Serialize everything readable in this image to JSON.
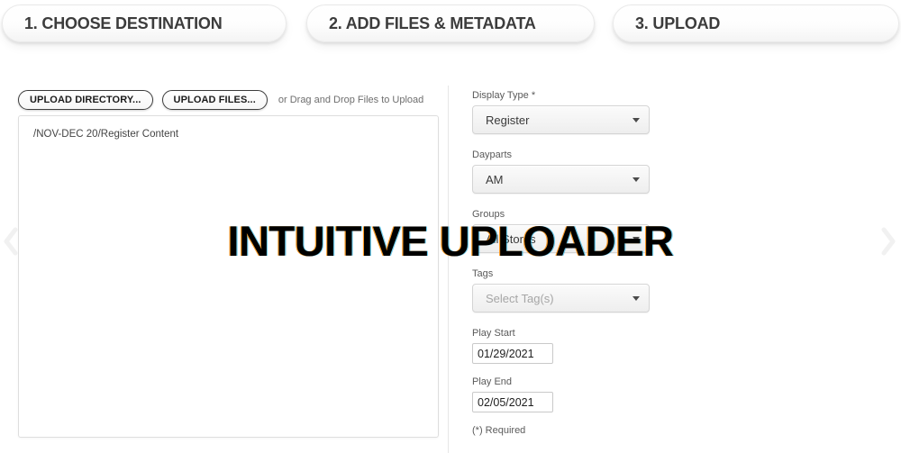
{
  "steps": {
    "tabs": [
      {
        "label": "1. CHOOSE DESTINATION",
        "name": "tab-choose-destination"
      },
      {
        "label": "2. ADD FILES & METADATA",
        "name": "tab-add-files-metadata"
      },
      {
        "label": "3. UPLOAD",
        "name": "tab-upload"
      }
    ]
  },
  "carousel": {
    "prev_icon": "chevron-left-icon",
    "next_icon": "chevron-right-icon"
  },
  "left_panel": {
    "upload_directory_label": "UPLOAD DIRECTORY...",
    "upload_files_label": "UPLOAD FILES...",
    "drag_hint": "or Drag and Drop Files to Upload",
    "drop_zone_file": "/NOV-DEC 20/Register Content"
  },
  "form": {
    "display_type": {
      "label": "Display Type *",
      "value": "Register",
      "caret_icon": "caret-down-icon"
    },
    "dayparts": {
      "label": "Dayparts",
      "value": "AM",
      "caret_icon": "caret-down-icon"
    },
    "groups": {
      "label": "Groups",
      "value": "All Stores",
      "caret_icon": "caret-down-icon"
    },
    "tags": {
      "label": "Tags",
      "placeholder": "Select Tag(s)",
      "value": "Select Tag(s)",
      "caret_icon": "caret-down-icon"
    },
    "play_start": {
      "label": "Play Start",
      "value": "01/29/2021"
    },
    "play_end": {
      "label": "Play End",
      "value": "02/05/2021"
    },
    "required_note": "(*) Required"
  },
  "overlay": {
    "headline": "INTUITIVE UPLOADER"
  },
  "colors": {
    "text_primary": "#3a3a3a",
    "text_muted": "#6e6e6e",
    "border": "#d4d4d4",
    "background": "#ffffff",
    "overlay_text": "#000000"
  }
}
